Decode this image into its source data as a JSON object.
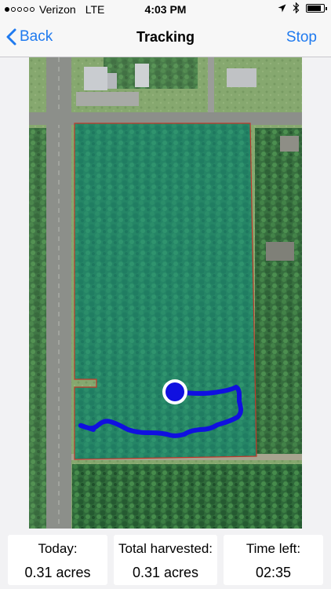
{
  "status_bar": {
    "carrier": "Verizon",
    "network": "LTE",
    "time": "4:03 PM",
    "signal_dots_filled": 1,
    "signal_dots_total": 5,
    "battery_level": 0.85,
    "icons": [
      "location-arrow-icon",
      "bluetooth-icon",
      "battery-icon"
    ]
  },
  "nav": {
    "back_label": "Back",
    "title": "Tracking",
    "stop_label": "Stop"
  },
  "map": {
    "type": "satellite",
    "field_fill_color": "#1e9a8a",
    "boundary_color": "#c0392b",
    "track_color": "#1010e0",
    "position_marker_color": "#1010e0"
  },
  "stats": [
    {
      "label": "Today:",
      "value": "0.31 acres"
    },
    {
      "label": "Total harvested:",
      "value": "0.31 acres"
    },
    {
      "label": "Time left:",
      "value": "02:35"
    }
  ],
  "colors": {
    "accent": "#1f7aef"
  }
}
